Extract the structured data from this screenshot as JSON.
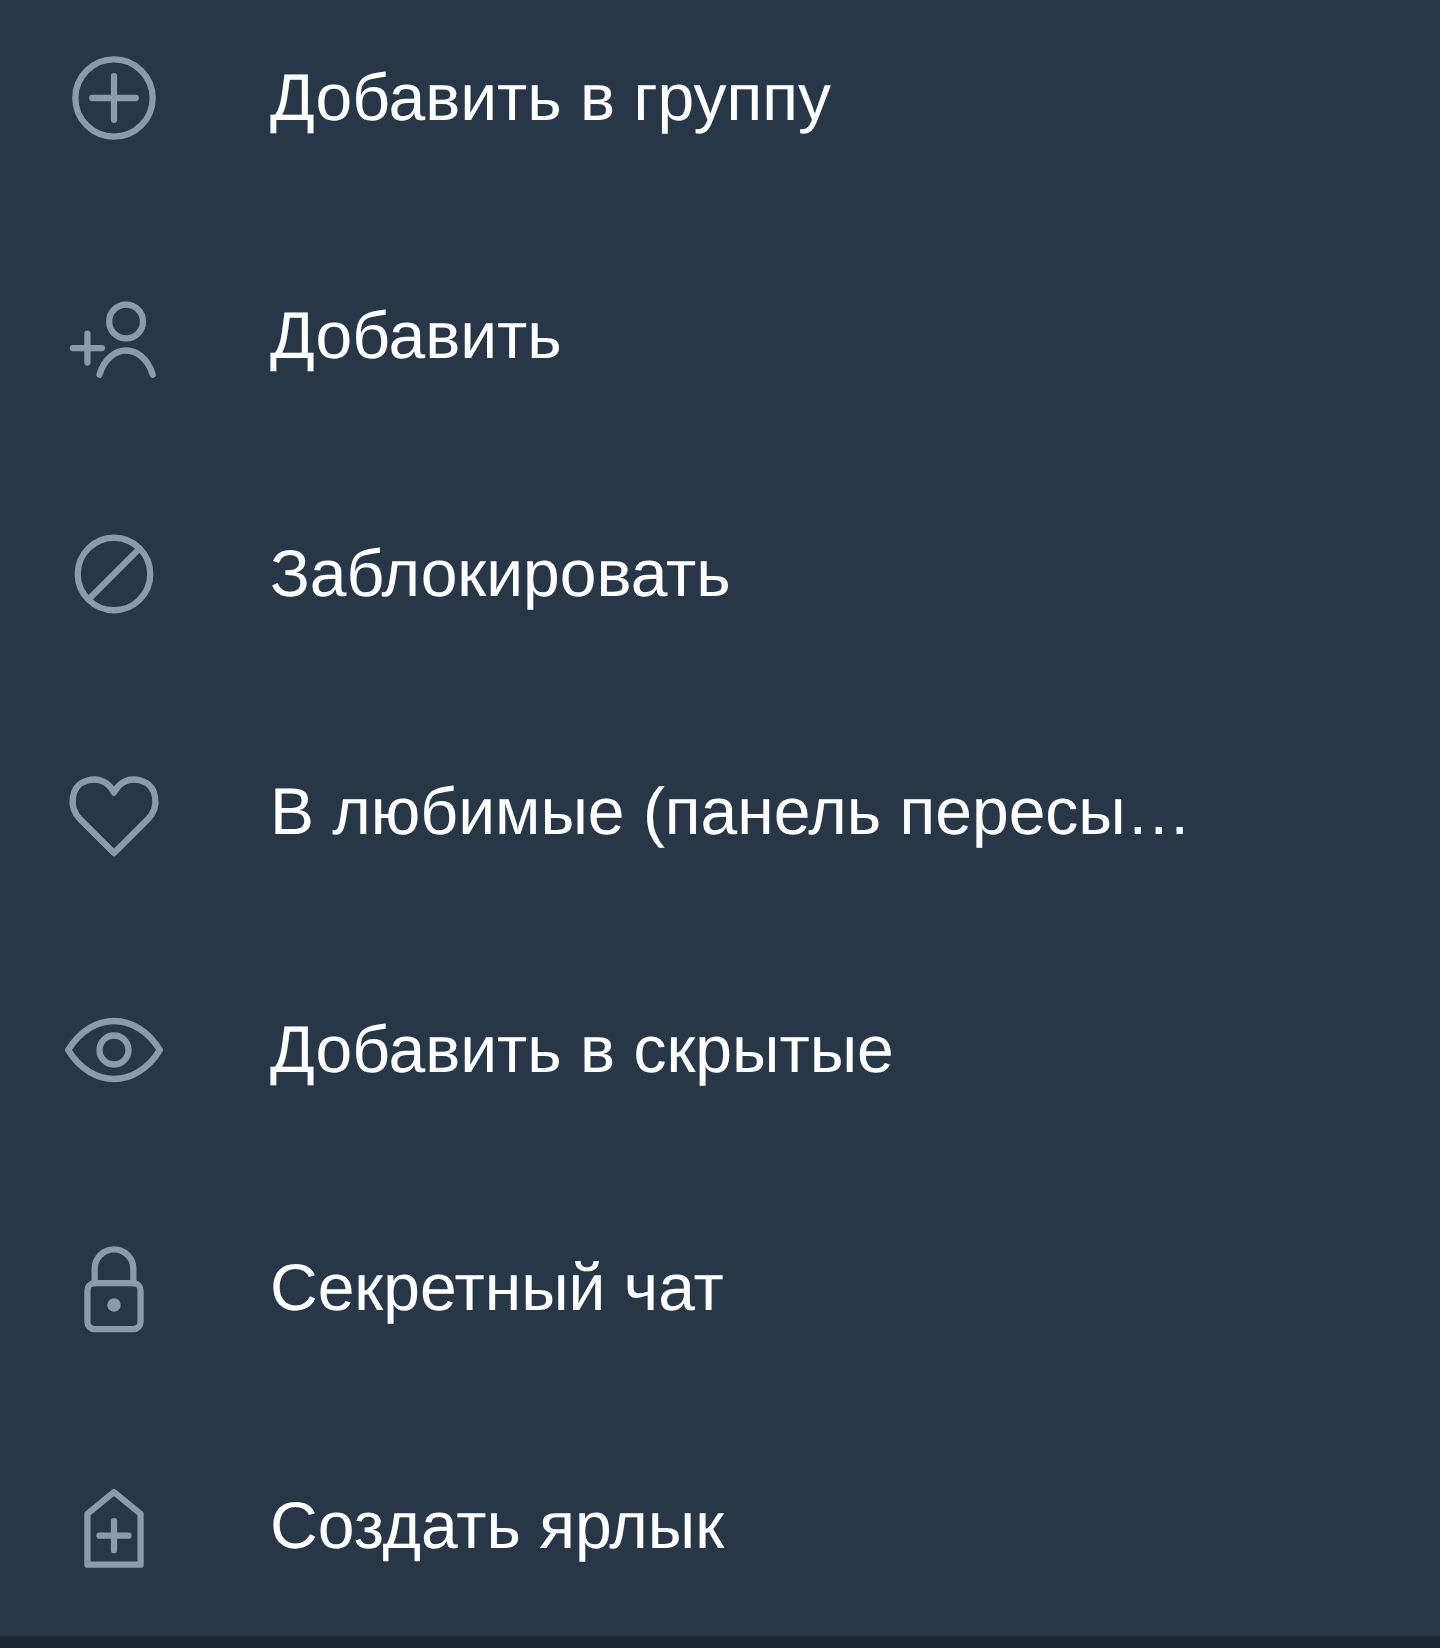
{
  "menu": {
    "items": [
      {
        "kind": "add-circle",
        "label": "Добавить в группу"
      },
      {
        "kind": "add-user",
        "label": "Добавить"
      },
      {
        "kind": "block",
        "label": "Заблокировать"
      },
      {
        "kind": "heart",
        "label": "В любимые (панель пересы…"
      },
      {
        "kind": "eye",
        "label": "Добавить в скрытые"
      },
      {
        "kind": "lock",
        "label": "Секретный чат"
      },
      {
        "kind": "add-home",
        "label": "Создать ярлык"
      }
    ]
  }
}
